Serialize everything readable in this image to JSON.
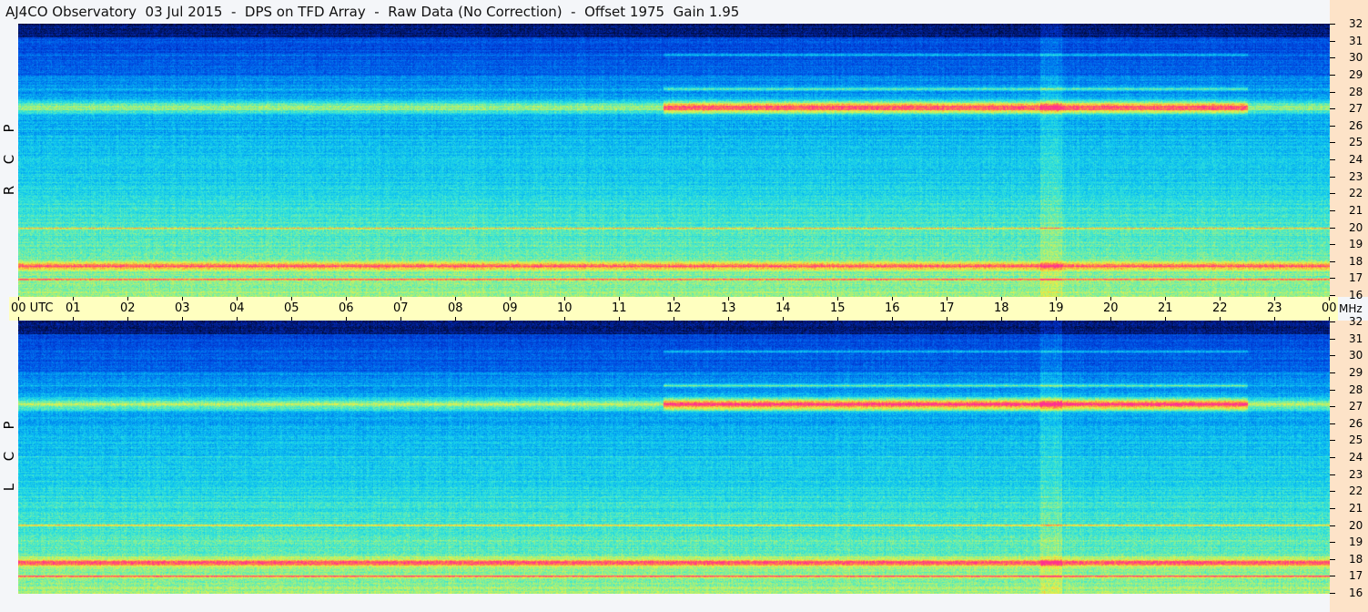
{
  "window": {
    "title": "AJ4CO Observatory  03 Jul 2015  -  DPS on TFD Array  -  Raw Data (No Correction)  -  Offset 1975  Gain 1.95"
  },
  "panels": {
    "top_label_letters": [
      "R",
      "C",
      "P"
    ],
    "bottom_label_letters": [
      "L",
      "C",
      "P"
    ]
  },
  "time_axis": {
    "labels": [
      "00 UTC",
      "01",
      "02",
      "03",
      "04",
      "05",
      "06",
      "07",
      "08",
      "09",
      "10",
      "11",
      "12",
      "13",
      "14",
      "15",
      "16",
      "17",
      "18",
      "19",
      "20",
      "21",
      "22",
      "23",
      "00"
    ],
    "unit": "MHz"
  },
  "freq_axis": {
    "labels": [
      "32",
      "31",
      "30",
      "29",
      "28",
      "27",
      "26",
      "25",
      "24",
      "23",
      "22",
      "21",
      "20",
      "19",
      "18",
      "17",
      "16"
    ]
  },
  "colors": {
    "time_axis_bg": "#ffffc0",
    "freq_axis_bg": "#fde3c8",
    "colormap": [
      "#000a2a",
      "#001a80",
      "#0030c8",
      "#0058e8",
      "#0090f0",
      "#10c8f0",
      "#40e8d0",
      "#a0f080",
      "#f0f040",
      "#ff9040",
      "#ff3090"
    ]
  },
  "chart_data": {
    "type": "heatmap",
    "title": "AJ4CO Observatory  03 Jul 2015  -  DPS on TFD Array  -  Raw Data (No Correction)  -  Offset 1975  Gain 1.95",
    "x_range_hours_utc": [
      0,
      24
    ],
    "y_range_mhz": [
      16,
      32
    ],
    "series": [
      {
        "name": "RCP",
        "strong_bands_mhz": [
          27.1,
          17.8,
          17.0,
          20.0,
          18.0
        ]
      },
      {
        "name": "LCP",
        "strong_bands_mhz": [
          27.1,
          17.8,
          17.0,
          20.0,
          18.0
        ]
      }
    ]
  }
}
